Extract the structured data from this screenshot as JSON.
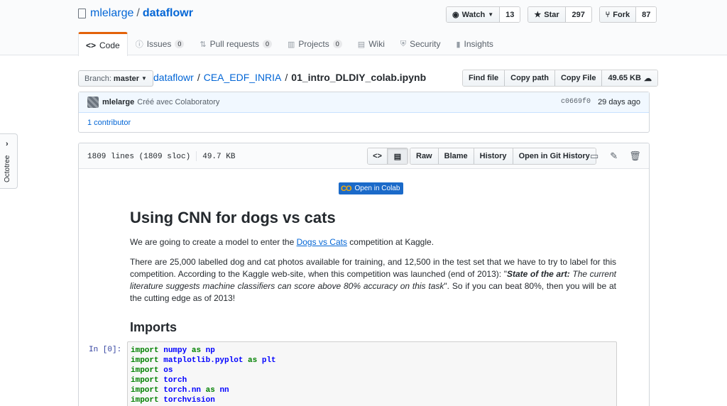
{
  "repo": {
    "owner": "mlelarge",
    "separator": "/",
    "name": "dataflowr"
  },
  "actions": {
    "watch_label": "Watch",
    "watch_count": "13",
    "star_label": "Star",
    "star_count": "297",
    "fork_label": "Fork",
    "fork_count": "87"
  },
  "tabs": [
    {
      "label": "Code",
      "icon": "code-icon"
    },
    {
      "label": "Issues",
      "count": "0",
      "icon": "issue-icon"
    },
    {
      "label": "Pull requests",
      "count": "0",
      "icon": "pull-request-icon"
    },
    {
      "label": "Projects",
      "count": "0",
      "icon": "project-icon"
    },
    {
      "label": "Wiki",
      "icon": "book-icon"
    },
    {
      "label": "Security",
      "icon": "shield-icon"
    },
    {
      "label": "Insights",
      "icon": "graph-icon"
    }
  ],
  "branch": {
    "prefix": "Branch:",
    "name": "master"
  },
  "breadcrumb": {
    "root": "dataflowr",
    "dir": "CEA_EDF_INRIA",
    "file": "01_intro_DLDIY_colab.ipynb",
    "sep": "/"
  },
  "file_nav": {
    "find": "Find file",
    "copy_path": "Copy path",
    "copy_file": "Copy File",
    "size": "49.65 KB"
  },
  "commit": {
    "author": "mlelarge",
    "message": "Créé avec Colaboratory",
    "sha": "c0669f0",
    "time": "29 days ago",
    "contributors": "1 contributor"
  },
  "file_header": {
    "lines": "1809 lines (1809 sloc)",
    "size": "49.7 KB",
    "raw": "Raw",
    "blame": "Blame",
    "history": "History",
    "git_history": "Open in Git History"
  },
  "notebook": {
    "colab_badge_logo": "CO",
    "colab_badge": "Open in Colab",
    "title": "Using CNN for dogs vs cats",
    "p1_before": "We are going to create a model to enter the ",
    "p1_link": "Dogs vs Cats",
    "p1_after": " competition at Kaggle.",
    "p2_a": "There are 25,000 labelled dog and cat photos available for training, and 12,500 in the test set that we have to try to label for this competition. According to the Kaggle web-site, when this competition was launched (end of 2013): \"",
    "p2_bold": "State of the art:",
    "p2_italic": " The current literature suggests machine classifiers can score above 80% accuracy on this task",
    "p2_b": "\". So if you can beat 80%, then you will be at the cutting edge as of 2013!",
    "h_imports": "Imports",
    "prompt": "In [0]:",
    "code": [
      {
        "kw": "import",
        "mod": "numpy",
        "kw2": "as",
        "alias": "np"
      },
      {
        "kw": "import",
        "mod": "matplotlib.pyplot",
        "kw2": "as",
        "alias": "plt"
      },
      {
        "kw": "import",
        "mod": "os"
      },
      {
        "kw": "import",
        "mod": "torch"
      },
      {
        "kw": "import",
        "mod": "torch.nn",
        "kw2": "as",
        "alias": "nn"
      },
      {
        "kw": "import",
        "mod": "torchvision"
      }
    ]
  },
  "octotree": {
    "label": "Octotree"
  }
}
